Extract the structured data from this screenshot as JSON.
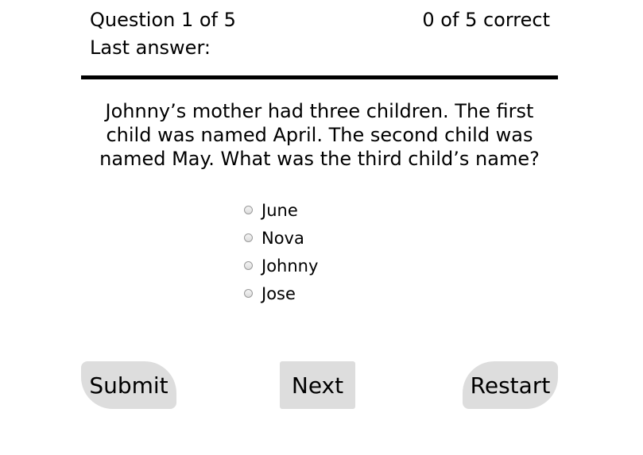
{
  "status": {
    "question_progress": "Question 1 of 5",
    "score": "0 of 5 correct",
    "last_answer_label": "Last answer:"
  },
  "question": {
    "text": "Johnny’s mother had three children. The first child was named April. The second child was named May. What was the third child’s name?"
  },
  "answers": [
    {
      "label": "June"
    },
    {
      "label": "Nova"
    },
    {
      "label": "Johnny"
    },
    {
      "label": "Jose"
    }
  ],
  "buttons": {
    "submit": "Submit",
    "next": "Next",
    "restart": "Restart"
  },
  "colors": {
    "button_bg": "#dddddd",
    "divider": "#000000"
  }
}
